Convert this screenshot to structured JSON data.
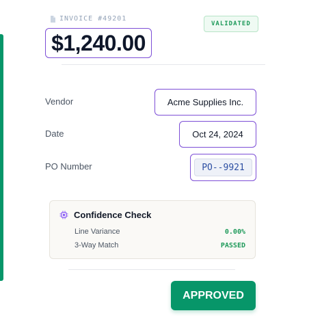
{
  "invoice": {
    "label": "INVOICE #49201",
    "amount": "$1,240.00",
    "status": "VALIDATED"
  },
  "fields": {
    "vendor_label": "Vendor",
    "vendor_value": "Acme Supplies Inc.",
    "date_label": "Date",
    "date_value": "Oct 24, 2024",
    "po_label": "PO Number",
    "po_value": "PO--9921"
  },
  "confidence": {
    "title": "Confidence Check",
    "rows": [
      {
        "key": "Line Variance",
        "value": "0.00%"
      },
      {
        "key": "3-Way Match",
        "value": "PASSED"
      }
    ]
  },
  "actions": {
    "approve_label": "APPROVED"
  },
  "icons": {
    "invoice": "document-icon",
    "confidence": "chip-icon"
  },
  "colors": {
    "accent_green": "#079669",
    "selection_purple": "#7c4dd6",
    "success_text": "#1e9a5a"
  }
}
